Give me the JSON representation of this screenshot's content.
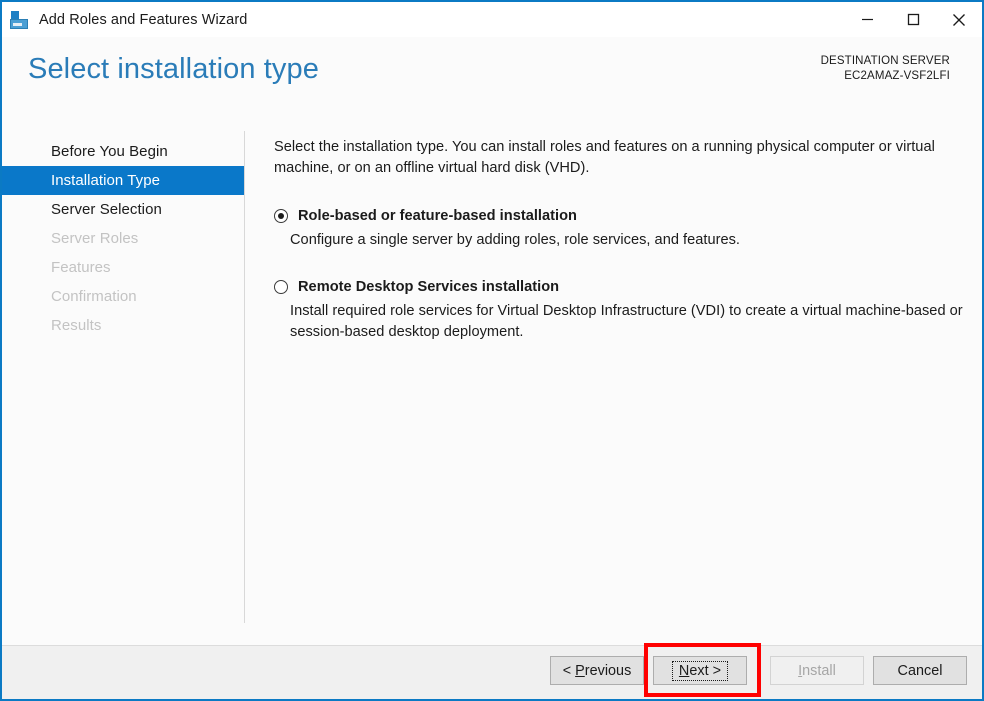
{
  "window": {
    "title": "Add Roles and Features Wizard",
    "icon": "server-roles-icon",
    "controls": {
      "minimize": "minimize-icon",
      "maximize": "maximize-icon",
      "close": "close-icon"
    }
  },
  "header": {
    "page_title": "Select installation type",
    "destination_label": "DESTINATION SERVER",
    "destination_name": "EC2AMAZ-VSF2LFI",
    "title_color": "#2a7cb8"
  },
  "nav": {
    "items": [
      {
        "label": "Before You Begin",
        "state": "enabled"
      },
      {
        "label": "Installation Type",
        "state": "selected"
      },
      {
        "label": "Server Selection",
        "state": "enabled"
      },
      {
        "label": "Server Roles",
        "state": "disabled"
      },
      {
        "label": "Features",
        "state": "disabled"
      },
      {
        "label": "Confirmation",
        "state": "disabled"
      },
      {
        "label": "Results",
        "state": "disabled"
      }
    ],
    "selected_color": "#0a78c9"
  },
  "content": {
    "intro": "Select the installation type. You can install roles and features on a running physical computer or virtual machine, or on an offline virtual hard disk (VHD).",
    "options": [
      {
        "label": "Role-based or feature-based installation",
        "description": "Configure a single server by adding roles, role services, and features.",
        "checked": true
      },
      {
        "label": "Remote Desktop Services installation",
        "description": "Install required role services for Virtual Desktop Infrastructure (VDI) to create a virtual machine-based or session-based desktop deployment.",
        "checked": false
      }
    ]
  },
  "footer": {
    "previous": {
      "prefix": "< ",
      "accel": "P",
      "rest": "revious"
    },
    "next": {
      "accel": "N",
      "rest": "ext",
      "suffix": " >"
    },
    "install": {
      "accel": "I",
      "rest": "nstall",
      "disabled": true
    },
    "cancel": {
      "label": "Cancel"
    },
    "highlight_color": "#ff0000",
    "focused_button": "next"
  }
}
